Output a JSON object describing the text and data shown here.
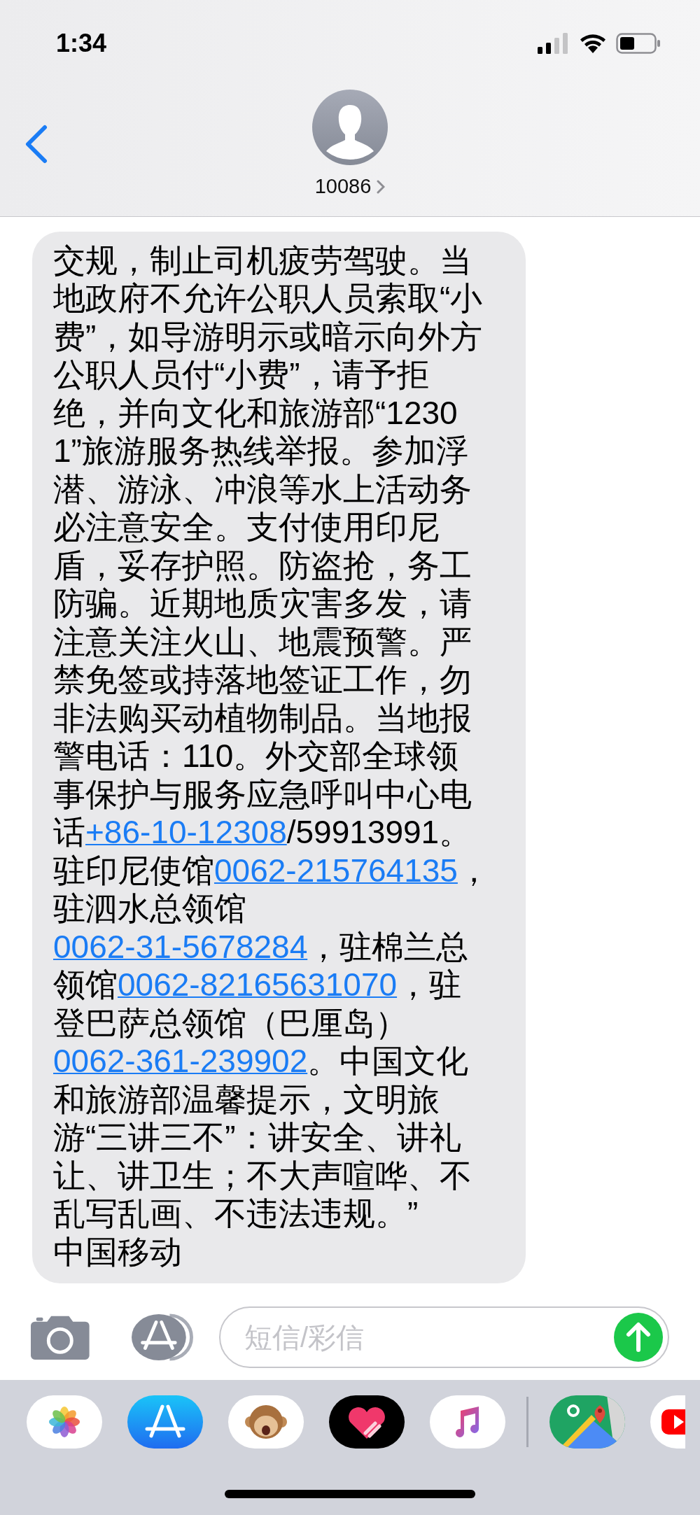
{
  "status_bar": {
    "time": "1:34"
  },
  "header": {
    "contact": "10086"
  },
  "message": {
    "segments": [
      {
        "kind": "text",
        "text": "交规，制止司机疲劳驾驶。当地政府不允许公职人员索取“小费”，如导游明示或暗示向外方公职人员付“小费”，请予拒绝，并向文化和旅游部“12301”旅游服务热线举报。参加浮潜、游泳、冲浪等水上活动务必注意安全。支付使用印尼盾，妥存护照。防盗抢，务工防骗。近期地质灾害多发，请注意关注火山、地震预警。严禁免签或持落地签证工作，勿非法购买动植物制品。当地报警电话：110。外交部全球领事保护与服务应急呼叫中心电话"
      },
      {
        "kind": "link",
        "text": "+86-10-12308"
      },
      {
        "kind": "text",
        "text": "/59913991。驻印尼使馆"
      },
      {
        "kind": "link",
        "text": "0062-215764135"
      },
      {
        "kind": "text",
        "text": "，驻泗水总领馆"
      },
      {
        "kind": "link",
        "text": "0062-31-5678284"
      },
      {
        "kind": "text",
        "text": "，驻棉兰总领馆"
      },
      {
        "kind": "link",
        "text": "0062-82165631070"
      },
      {
        "kind": "text",
        "text": "，驻登巴萨总领馆（巴厘岛）"
      },
      {
        "kind": "link",
        "text": "0062-361-239902"
      },
      {
        "kind": "text",
        "text": "。中国文化和旅游部温馨提示，文明旅游“三讲三不”：讲安全、讲礼让、讲卫生；不大声喧哗、不乱写乱画、不违法违规。”"
      }
    ],
    "signature": "中国移动"
  },
  "composer": {
    "placeholder": "短信/彩信"
  },
  "app_drawer": [
    {
      "kind": "photos"
    },
    {
      "kind": "appstore"
    },
    {
      "kind": "monkey"
    },
    {
      "kind": "heart"
    },
    {
      "kind": "music"
    },
    {
      "kind": "maps"
    },
    {
      "kind": "video"
    }
  ]
}
